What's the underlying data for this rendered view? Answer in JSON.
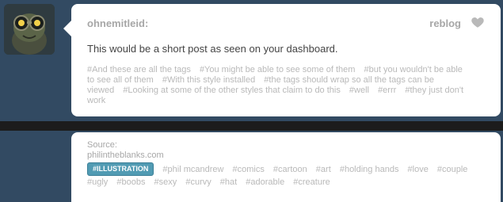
{
  "post": {
    "author": "ohnemitleid:",
    "reblog_label": "reblog",
    "body": "This would be a short post as seen on your dashboard.",
    "tags": [
      "#And these are all the tags",
      "#You might be able to see some of them",
      "#but you wouldn't be able to see all of them",
      "#With this style installed",
      "#the tags should wrap so all the tags can be viewed",
      "#Looking at some of the other styles that claim to do this",
      "#well",
      "#errr",
      "#they just don't work"
    ]
  },
  "post2": {
    "source_label": "Source:",
    "source_url": "philintheblanks.com",
    "featured_tag": "#ILLUSTRATION",
    "tags": [
      "#phil mcandrew",
      "#comics",
      "#cartoon",
      "#art",
      "#holding hands",
      "#love",
      "#couple",
      "#ugly",
      "#boobs",
      "#sexy",
      "#curvy",
      "#hat",
      "#adorable",
      "#creature"
    ]
  },
  "colors": {
    "background": "#324a62",
    "card": "#ffffff",
    "muted_text": "#a7a7a7",
    "tag_text": "#b9b9b9",
    "featured_tag_bg": "#519bb3",
    "divider": "#1c1c1c"
  },
  "icons": {
    "heart": "heart-icon"
  }
}
